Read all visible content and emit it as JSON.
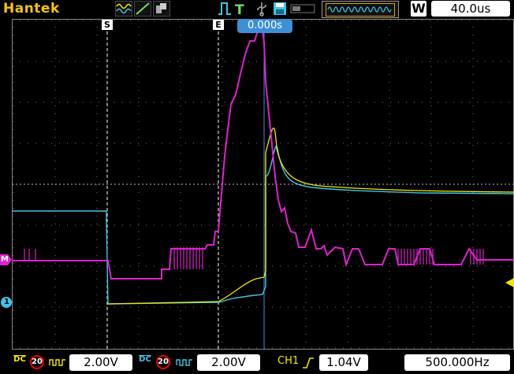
{
  "top_bar": {
    "brand": "Hantek",
    "timebase": "40.0us",
    "w_label": "W",
    "icons": [
      "channel-waveform-icon",
      "math-ramp-icon",
      "reference-icon",
      "pulse-trigger-icon",
      "trigger-t-icon",
      "usb-icon",
      "save-disk-icon",
      "memory-bar-icon"
    ]
  },
  "markers": {
    "start": "S",
    "end": "E",
    "time_offset": "0.000s",
    "ch_m_level": "M",
    "ch_level": "1"
  },
  "bottom_bar": {
    "ch1_coupling": "DC",
    "ch1_bw": "20",
    "ch1_volts": "2.00V",
    "ch2_coupling": "DC",
    "ch2_bw": "20",
    "ch2_volts": "2.00V",
    "trigger_source": "CH1",
    "trigger_level": "1.04V",
    "frequency": "500.000Hz"
  },
  "colors": {
    "brand": "#f5c400",
    "ch1": "#f5e600",
    "ch2": "#3fc4e6",
    "math": "#e020d0",
    "grid": "#ffffff",
    "accent": "#3d8fd6"
  }
}
